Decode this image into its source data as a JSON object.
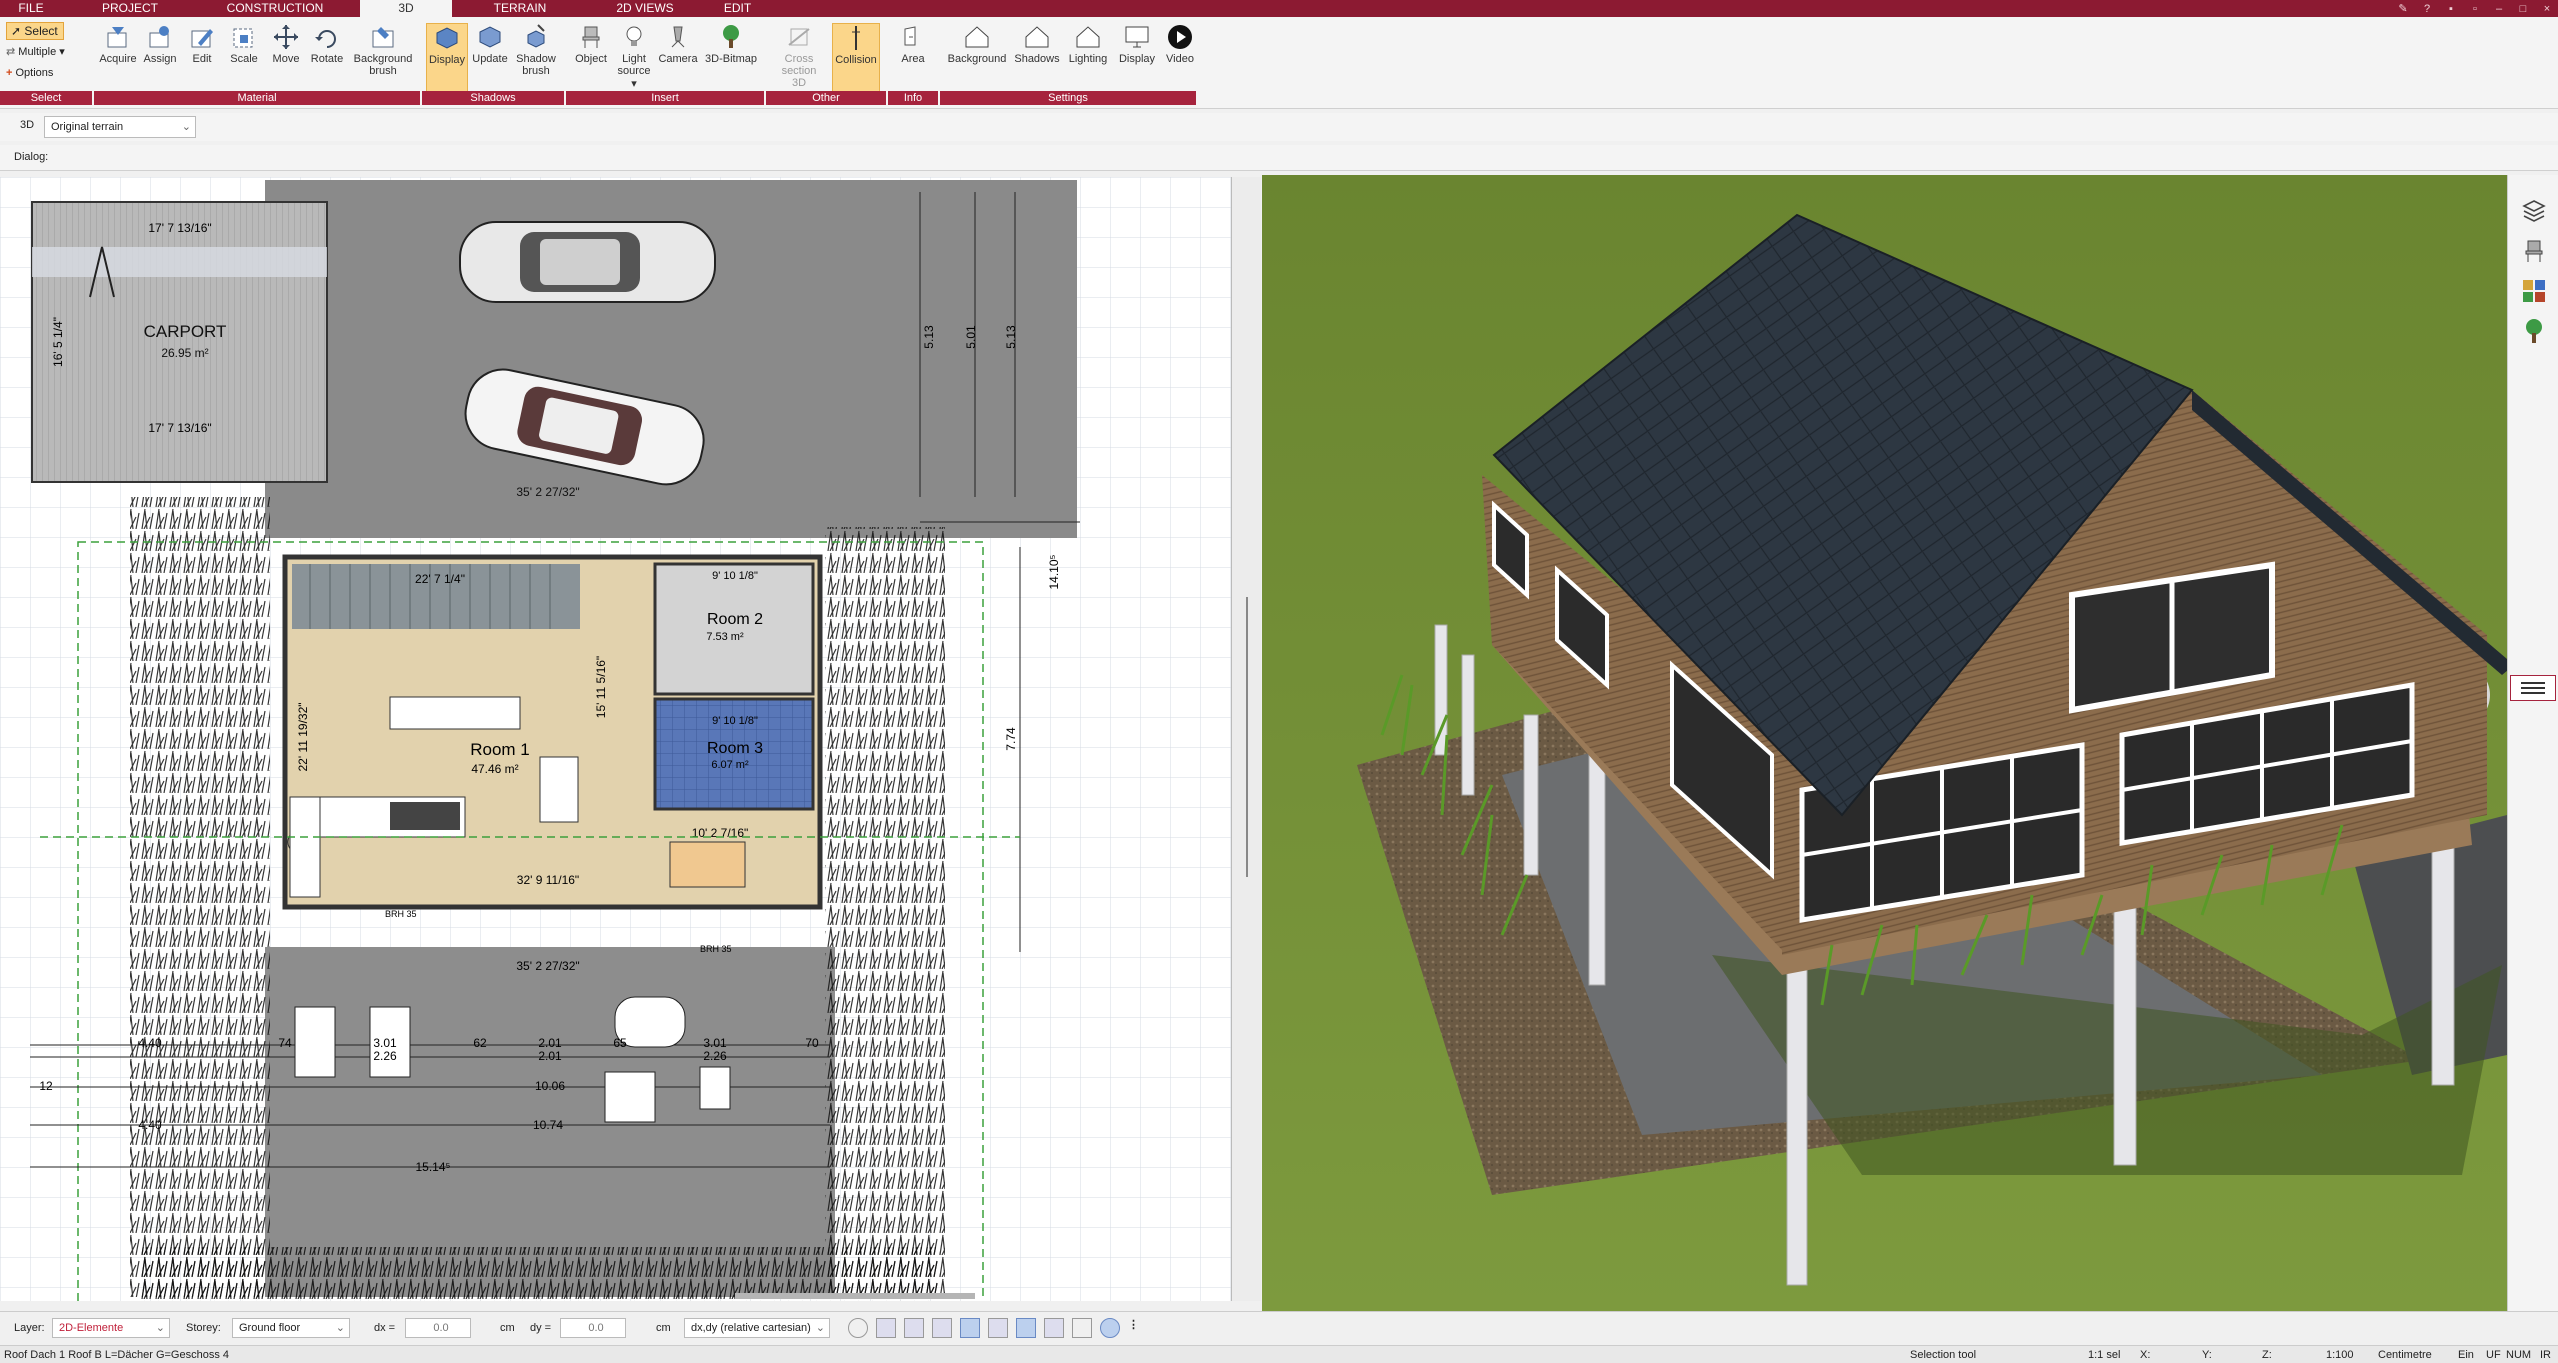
{
  "tabs": [
    "FILE",
    "PROJECT",
    "CONSTRUCTION",
    "3D",
    "TERRAIN",
    "2D VIEWS",
    "EDIT"
  ],
  "ribbon": {
    "select_label": "Select",
    "multiple_label": "Multiple",
    "options_label": "Options",
    "buttons": {
      "acquire": "Acquire",
      "assign": "Assign",
      "edit": "Edit",
      "scale": "Scale",
      "move": "Move",
      "rotate": "Rotate",
      "bg_brush": "Background brush",
      "display_shadows": "Display",
      "update": "Update",
      "shadow_brush": "Shadow brush",
      "object": "Object",
      "light_source": "Light source",
      "camera": "Camera",
      "bitmap": "3D-Bitmap",
      "cross_section": "Cross section 3D",
      "collision": "Collision",
      "area": "Area",
      "background": "Background",
      "shadows": "Shadows",
      "lighting": "Lighting",
      "display": "Display",
      "video": "Video"
    },
    "groups": {
      "select": "Select",
      "material": "Material",
      "shadows": "Shadows",
      "insert": "Insert",
      "other": "Other",
      "info": "Info",
      "settings": "Settings"
    }
  },
  "toolbar": {
    "mode_label": "3D",
    "terrain_option": "Original terrain",
    "dialog_label": "Dialog:"
  },
  "plan": {
    "carport_label": "CARPORT",
    "carport_area": "26.95 m²",
    "dim_carport_top": "17' 7 13/16\"",
    "dim_carport_bottom": "17' 7 13/16\"",
    "dim_carport_side": "16' 5 1/4\"",
    "dim_top_width": "35' 2 27/32\"",
    "dim_bottom_width": "35' 2 27/32\"",
    "dim_513a": "5.13",
    "dim_501": "5.01",
    "dim_513b": "5.13",
    "dim_1410": "14.10⁵",
    "dim_774": "7.74",
    "room1_label": "Room 1",
    "room1_area": "47.46 m²",
    "room2_label": "Room 2",
    "room2_area": "7.53 m²",
    "room3_label": "Room 3",
    "room3_area": "6.07 m²",
    "dim_stairs": "22' 7 1/4\"",
    "dim_room2_top": "9' 10 1/8\"",
    "dim_room3_top": "9' 10 1/8\"",
    "dim_room1_vert": "15' 11 5/16\"",
    "dim_left_vert": "22' 11 19/32\"",
    "dim_kitchen": "32' 9 11/16\"",
    "dim_dining": "10' 2 7/16\"",
    "dim_bottom_1514": "15.14⁵",
    "dim_1074": "10.74",
    "dim_1006": "10.06",
    "dim_201a": "2.01",
    "dim_201b": "2.01",
    "dim_301a": "3.01",
    "dim_301b": "3.01",
    "dim_226a": "2.26",
    "dim_226b": "2.26",
    "dim_74": "74",
    "dim_62": "62",
    "dim_65": "65",
    "dim_70": "70",
    "dim_440a": "4.40",
    "dim_440b": "4.40",
    "dim_12": "12",
    "brh_a": "BRH 35",
    "brh_b": "BRH 35"
  },
  "status": {
    "layer_label": "Layer:",
    "layer_value": "2D-Elemente",
    "storey_label": "Storey:",
    "storey_value": "Ground floor",
    "dx_label": "dx =",
    "dx_value": "0.0",
    "dy_label": "dy =",
    "dy_value": "0.0",
    "unit_cm": "cm",
    "coord_mode": "dx,dy (relative cartesian)",
    "info_text": "Roof Dach 1 Roof B L=Dächer G=Geschoss 4",
    "tool": "Selection tool",
    "selection": "1:1 sel",
    "x_label": "X:",
    "y_label": "Y:",
    "z_label": "Z:",
    "scale": "1:100",
    "units": "Centimetre",
    "ein": "Ein",
    "uf": "UF",
    "num": "NUM",
    "ir": "IR"
  },
  "colors": {
    "brand": "#8c1a32",
    "group": "#a6233d",
    "active_btn": "#fbd68a",
    "roof": "#2c3540",
    "wood": "#8a6a4a",
    "grass": "#6f8a35"
  }
}
